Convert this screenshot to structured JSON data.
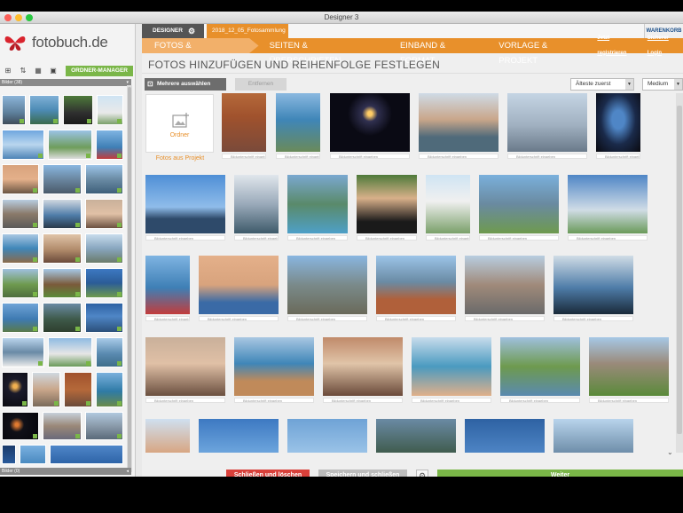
{
  "window": {
    "title": "Designer 3"
  },
  "logo": {
    "text": "fotobuch.de"
  },
  "sidebar": {
    "ordner_manager": "ORDNER-MANAGER",
    "section_top": "Bilder (38)",
    "section_bottom": "Bilder (0)"
  },
  "tabs": {
    "designer": "DESIGNER",
    "project": "2018_12_05_Fotosammlung",
    "warenkorb": "WARENKORB"
  },
  "nav": {
    "steps": [
      "FOTOS & REIHENFOLGE",
      "SEITEN & ÜBERSCHRIFTEN",
      "EINBAND & FORMAT",
      "VORLAGE & PROJEKT"
    ],
    "register": "Jetzt registrieren",
    "login": "Sicherer Login"
  },
  "page": {
    "title": "FOTOS HINZUFÜGEN UND REIHENFOLGE FESTLEGEN"
  },
  "actions": {
    "multi_select": "Mehrere auswählen",
    "remove": "Entfernen",
    "sort": "Älteste zuerst",
    "size": "Medium"
  },
  "folder": {
    "label": "Ordner",
    "from_project": "Fotos aus Projekt"
  },
  "caption_placeholder": "Bildunterschrift eingeben",
  "bottom": {
    "close_delete": "Schließen und löschen",
    "save_close": "Speichern und schließen",
    "next": "Weiter"
  },
  "colors": {
    "orange": "#e8902b",
    "green": "#7ab648",
    "red": "#d9403a"
  }
}
